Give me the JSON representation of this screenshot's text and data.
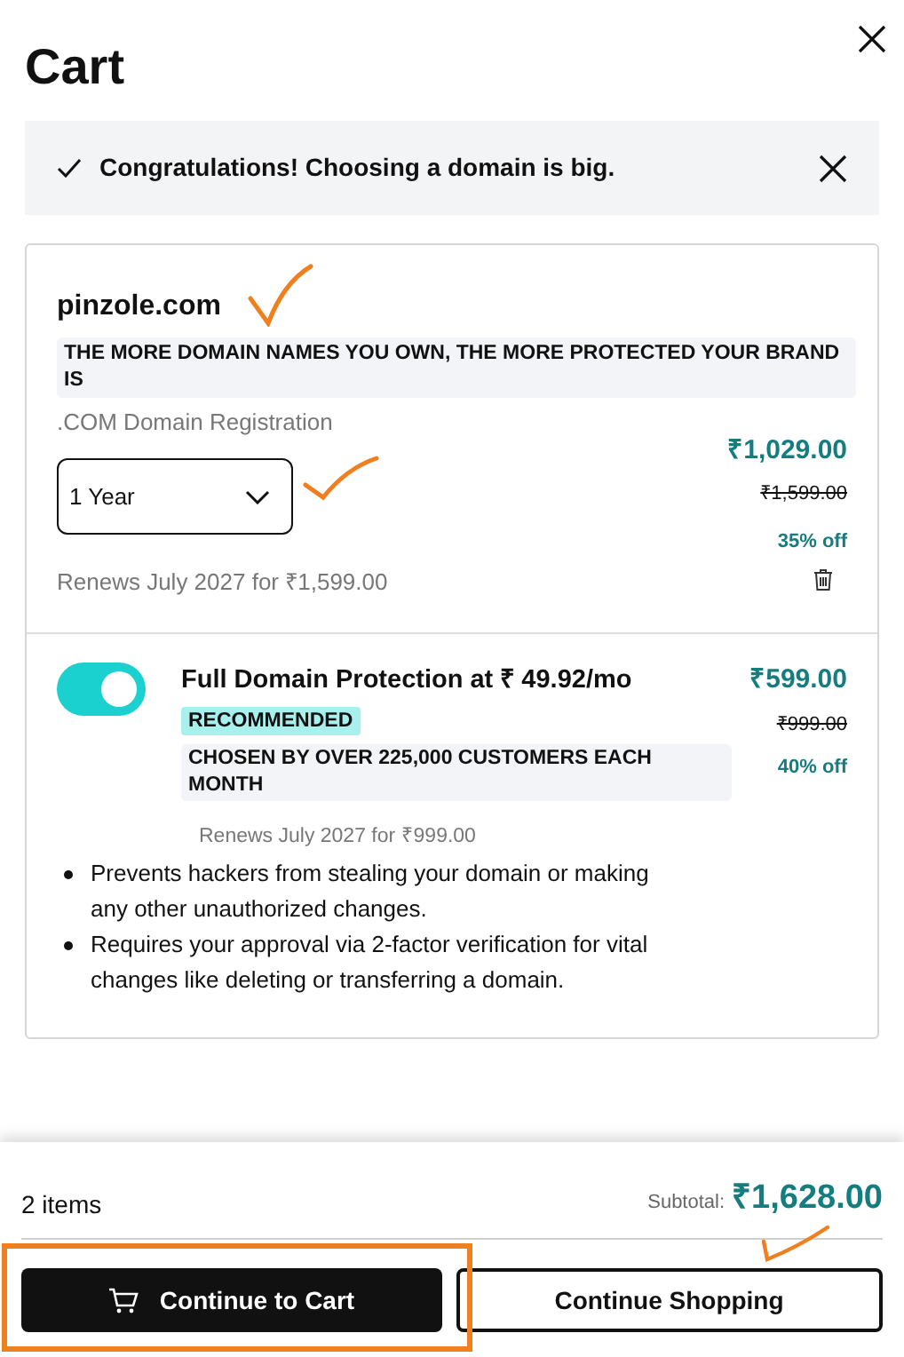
{
  "title": "Cart",
  "banner": {
    "text": "Congratulations! Choosing a domain is big."
  },
  "domain": {
    "name": "pinzole.com",
    "tagline": "THE MORE DOMAIN NAMES YOU OWN, THE MORE PROTECTED YOUR BRAND IS",
    "product": ".COM Domain Registration",
    "term": "1 Year",
    "price": "₹1,029.00",
    "old_price": "₹1,599.00",
    "discount": "35% off",
    "renews": "Renews July 2027 for ₹1,599.00"
  },
  "protection": {
    "on": true,
    "title": "Full Domain Protection at ₹ 49.92/mo",
    "badge": "RECOMMENDED",
    "note": "CHOSEN BY OVER 225,000 CUSTOMERS EACH MONTH",
    "price": "₹599.00",
    "old_price": "₹999.00",
    "discount": "40% off",
    "renews": "Renews July 2027 for ₹999.00",
    "features": [
      "Prevents hackers from stealing your domain or making any other unauthorized changes.",
      "Requires your approval via 2-factor verification for vital changes like deleting or transferring a domain."
    ]
  },
  "footer": {
    "count": "2 items",
    "subtotal_label": "Subtotal:",
    "subtotal": "₹1,628.00",
    "buttons": [
      {
        "label": "Continue to Cart",
        "kind": "primary"
      },
      {
        "label": "Continue Shopping",
        "kind": "secondary"
      }
    ]
  }
}
